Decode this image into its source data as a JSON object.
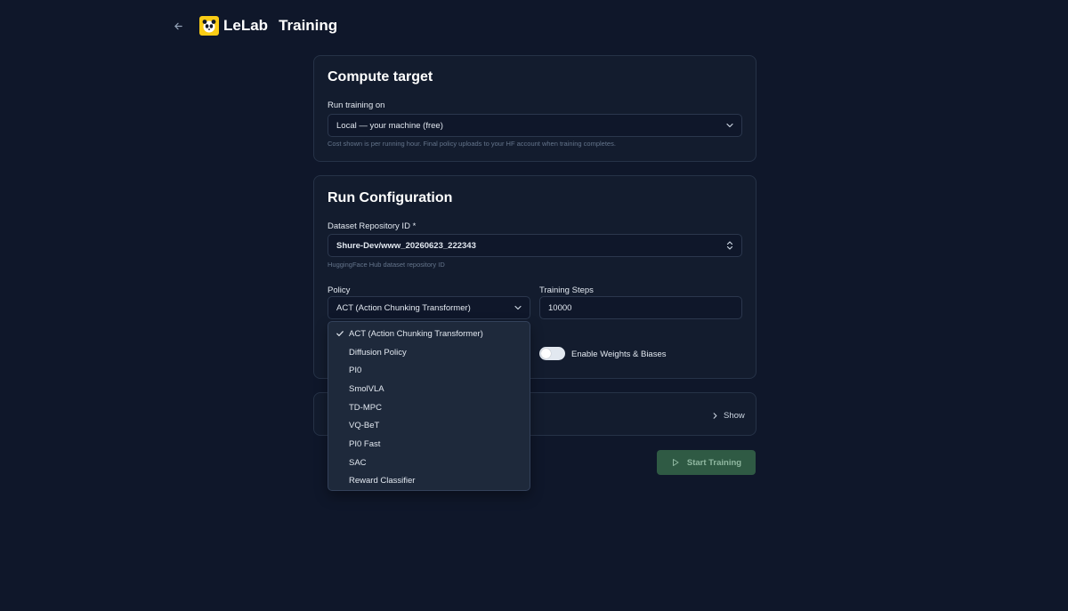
{
  "header": {
    "brand": "LeLab",
    "title": "Training"
  },
  "compute": {
    "title": "Compute target",
    "run_label": "Run training on",
    "run_value": "Local — your machine (free)",
    "helper": "Cost shown is per running hour. Final policy uploads to your HF account when training completes."
  },
  "config": {
    "title": "Run Configuration",
    "dataset_label": "Dataset Repository ID *",
    "dataset_value": "Shure-Dev/www_20260623_222343",
    "dataset_helper": "HuggingFace Hub dataset repository ID",
    "policy_label": "Policy",
    "policy_value": "ACT (Action Chunking Transformer)",
    "steps_label": "Training Steps",
    "steps_value": "10000",
    "wandb_label": "Enable Weights & Biases",
    "wandb_enabled": false
  },
  "advanced": {
    "toggle_label": "Show"
  },
  "actions": {
    "start_label": "Start Training"
  },
  "policy_options": [
    "ACT (Action Chunking Transformer)",
    "Diffusion Policy",
    "PI0",
    "SmolVLA",
    "TD-MPC",
    "VQ-BeT",
    "PI0 Fast",
    "SAC",
    "Reward Classifier"
  ],
  "selected_policy_index": 0,
  "icons": {
    "back": "arrow-left-icon",
    "logo": "panda-logo-icon",
    "chevron": "chevron-down-icon",
    "updown": "chevron-up-down-icon",
    "check": "check-icon",
    "show": "chevron-right-icon",
    "play": "play-icon"
  },
  "colors": {
    "background": "#0f172a",
    "card": "#131c2e",
    "logo": "#facc15",
    "start_button": "#2f5a44"
  }
}
